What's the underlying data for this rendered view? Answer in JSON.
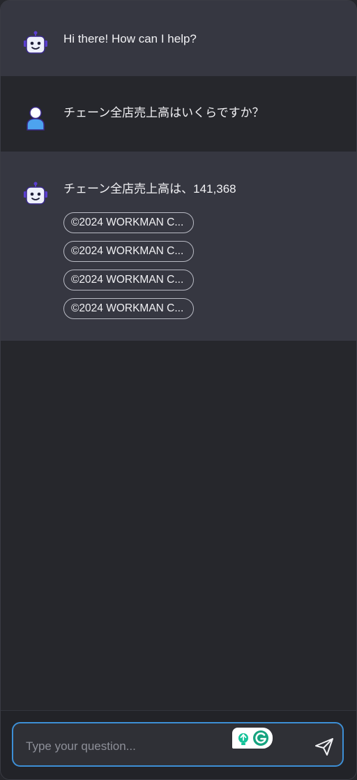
{
  "messages": [
    {
      "role": "bot",
      "text": "Hi there! How can I help?"
    },
    {
      "role": "user",
      "text": "チェーン全店売上高はいくらですか？"
    },
    {
      "role": "bot",
      "text": "チェーン全店売上高は、141,368",
      "sources": [
        "©2024 WORKMAN C...",
        "©2024 WORKMAN C...",
        "©2024 WORKMAN C...",
        "©2024 WORKMAN C..."
      ]
    }
  ],
  "composer": {
    "placeholder": "Type your question..."
  },
  "colors": {
    "bot_bg": "#363741",
    "page_bg": "#26272c",
    "input_border": "#3d8fd6",
    "avatar_accent": "#5b3fd0"
  },
  "icons": [
    "robot-icon",
    "user-icon",
    "grammarly-icon",
    "send-icon"
  ]
}
